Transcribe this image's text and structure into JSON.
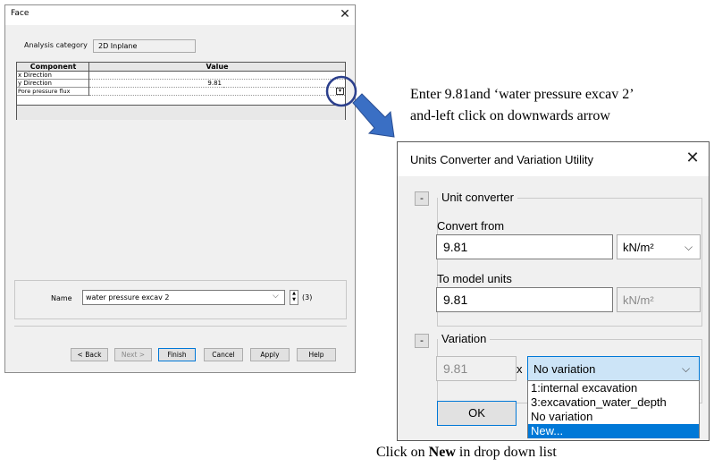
{
  "face_dialog": {
    "title": "Face",
    "close_icon": "close-icon",
    "analysis_category": {
      "label": "Analysis category",
      "value": "2D Inplane"
    },
    "grid": {
      "headers": [
        "Component",
        "Value"
      ],
      "rows": [
        {
          "component": "x Direction",
          "value": ""
        },
        {
          "component": "y Direction",
          "value": "9.81"
        },
        {
          "component": "Pore pressure flux",
          "value": ""
        }
      ]
    },
    "name": {
      "label": "Name",
      "value": "water pressure excav 2",
      "count": "(3)"
    },
    "buttons": {
      "back": "< Back",
      "next": "Next >",
      "finish": "Finish",
      "cancel": "Cancel",
      "apply": "Apply",
      "help": "Help"
    }
  },
  "annotations": {
    "instruction_1": "Enter 9.81and ‘water pressure excav 2’",
    "instruction_2": "and-left click on downwards arrow",
    "instruction_3_prefix": "Click on ",
    "instruction_3_bold": "New",
    "instruction_3_suffix": " in drop down list",
    "highlight_color": "#2b3f8c",
    "arrow_color": "#3a6fc4"
  },
  "units_dialog": {
    "title": "Units Converter and Variation Utility",
    "unit_converter": {
      "collapse_label": "-",
      "group_label": "Unit converter",
      "convert_from_label": "Convert from",
      "convert_from_value": "9.81",
      "convert_from_unit": "kN/m²",
      "to_model_label": "To model units",
      "to_model_value": "9.81",
      "to_model_unit": "kN/m²"
    },
    "variation": {
      "collapse_label": "-",
      "group_label": "Variation",
      "value": "9.81",
      "multiplier": "x",
      "selected": "No variation",
      "options": [
        "1:internal excavation",
        "3:excavation_water_depth",
        "No variation",
        "New..."
      ],
      "highlighted_option": "New..."
    },
    "ok_label": "OK",
    "accent_color": "#0078d7"
  }
}
